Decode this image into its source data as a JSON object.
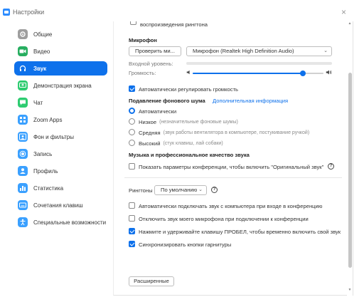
{
  "window": {
    "title": "Настройки",
    "close_symbol": "×"
  },
  "colors": {
    "accent": "#0e71eb"
  },
  "sidebar": {
    "items": [
      {
        "label": "Общие",
        "icon": "gear-icon",
        "color": "#9e9e9e"
      },
      {
        "label": "Видео",
        "icon": "video-camera-icon",
        "color": "#27ae60"
      },
      {
        "label": "Звук",
        "icon": "headphones-icon",
        "color": "#0e71eb",
        "active": true
      },
      {
        "label": "Демонстрация экрана",
        "icon": "share-screen-icon",
        "color": "#2ecc71"
      },
      {
        "label": "Чат",
        "icon": "chat-icon",
        "color": "#2ecc71"
      },
      {
        "label": "Zoom Apps",
        "icon": "apps-icon",
        "color": "#3aa0ff"
      },
      {
        "label": "Фон и фильтры",
        "icon": "background-icon",
        "color": "#3aa0ff"
      },
      {
        "label": "Запись",
        "icon": "record-icon",
        "color": "#3aa0ff"
      },
      {
        "label": "Профиль",
        "icon": "profile-icon",
        "color": "#3aa0ff"
      },
      {
        "label": "Статистика",
        "icon": "statistics-icon",
        "color": "#3aa0ff"
      },
      {
        "label": "Сочетания клавиш",
        "icon": "keyboard-icon",
        "color": "#3aa0ff"
      },
      {
        "label": "Специальные возможности",
        "icon": "accessibility-icon",
        "color": "#3aa0ff"
      }
    ]
  },
  "content": {
    "top_partial_label": "воспроизведения рингтона",
    "mic": {
      "heading": "Микрофон",
      "test_button": "Проверить ми...",
      "device": "Микрофон (Realtek High Definition Audio)",
      "input_level_label": "Входной уровень:",
      "volume_label": "Громкость:",
      "volume_value": 0.84,
      "auto_adjust": {
        "label": "Автоматически регулировать громкость",
        "checked": true
      }
    },
    "noise": {
      "heading": "Подавление фонового шума",
      "link": "Дополнительная информация",
      "options": [
        {
          "label": "Автоматически",
          "hint": "",
          "checked": true
        },
        {
          "label": "Низкое",
          "hint": "(незначительные фоновые шумы)",
          "checked": false
        },
        {
          "label": "Средняя",
          "hint": "(звук работы вентилятора в компьютере, постукивание ручкой)",
          "checked": false
        },
        {
          "label": "Высокий",
          "hint": "(стук клавиш, лай собаки)",
          "checked": false
        }
      ]
    },
    "music": {
      "heading": "Музыка и профессиональное качество звука",
      "option": {
        "label": "Показать параметры конференции, чтобы включить \"Оригинальный звук\"",
        "checked": false
      },
      "help_symbol": "?"
    },
    "ringtones": {
      "label": "Рингтоны",
      "value": "По умолчанию",
      "help_symbol": "?"
    },
    "options": [
      {
        "label": "Автоматически подключать звук с компьютера при входе в конференцию",
        "checked": false
      },
      {
        "label": "Отключить звук моего микрофона при подключении к конференции",
        "checked": false
      },
      {
        "label": "Нажмите и удерживайте клавишу ПРОБЕЛ, чтобы временно включить свой звук",
        "checked": true
      },
      {
        "label": "Синхронизировать кнопки гарнитуры",
        "checked": true
      }
    ],
    "advanced_button": "Расширенные"
  }
}
